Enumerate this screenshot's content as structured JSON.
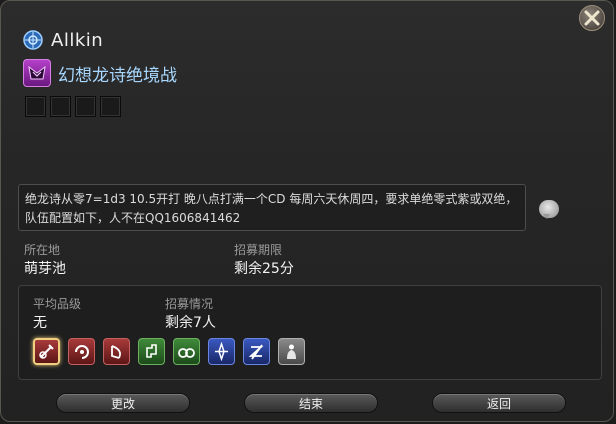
{
  "player": {
    "name": "Allkin",
    "world_icon": "world-globe-icon"
  },
  "duty": {
    "name": "幻想龙诗绝境战",
    "icon": "ultimate-duty-icon"
  },
  "comment": "绝龙诗从零7=1d3 10.5开打 晚八点打满一个CD 每周六天休周四，要求单绝零式紫或双绝，队伍配置如下，人不在QQ1606841462",
  "location": {
    "label": "所在地",
    "value": "萌芽池"
  },
  "recruit_period": {
    "label": "招募期限",
    "value": "剩余25分"
  },
  "avg_ilvl": {
    "label": "平均品级",
    "value": "无"
  },
  "recruit_status": {
    "label": "招募情况",
    "value": "剩余7人"
  },
  "jobs": [
    {
      "icon": "paladin-icon",
      "color": "red",
      "selected": true
    },
    {
      "icon": "warrior-icon",
      "color": "red",
      "selected": false
    },
    {
      "icon": "bard-icon",
      "color": "red",
      "selected": false
    },
    {
      "icon": "monk-icon",
      "color": "green",
      "selected": false
    },
    {
      "icon": "dragoon-icon",
      "color": "green",
      "selected": false
    },
    {
      "icon": "white-mage-icon",
      "color": "blue",
      "selected": false
    },
    {
      "icon": "scholar-icon",
      "color": "blue",
      "selected": false
    },
    {
      "icon": "astrologian-icon",
      "color": "gray",
      "selected": false
    }
  ],
  "buttons": {
    "change": "更改",
    "end": "结束",
    "back": "返回"
  }
}
